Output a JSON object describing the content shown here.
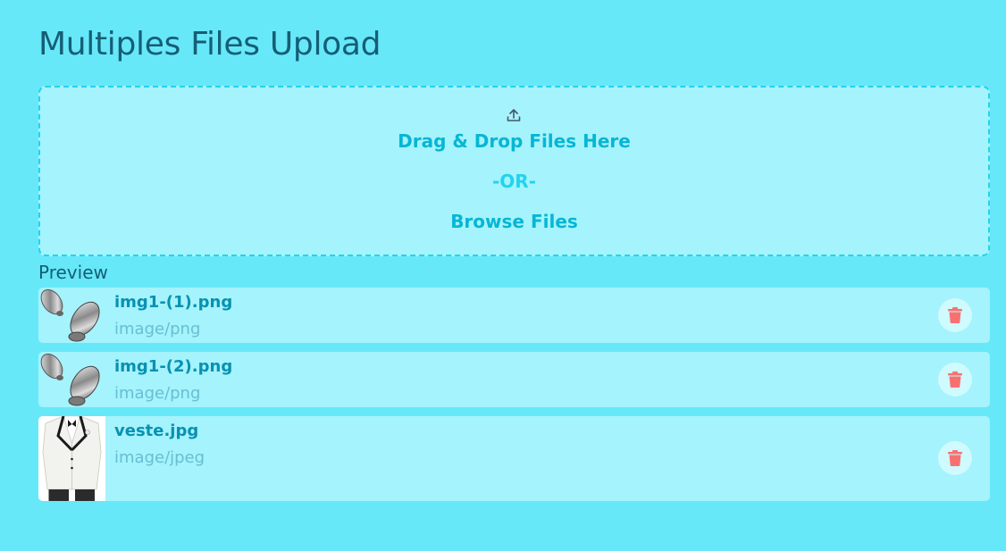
{
  "page": {
    "title": "Multiples Files Upload"
  },
  "dropzone": {
    "icon": "upload-icon",
    "drag_text": "Drag & Drop Files Here",
    "or_text": "-OR-",
    "browse_text": "Browse Files"
  },
  "preview": {
    "label": "Preview",
    "files": [
      {
        "name": "img1-(1).png",
        "type": "image/png",
        "thumbnail": "chrome-spoon-thumbnail"
      },
      {
        "name": "img1-(2).png",
        "type": "image/png",
        "thumbnail": "chrome-spoon-thumbnail"
      },
      {
        "name": "veste.jpg",
        "type": "image/jpeg",
        "thumbnail": "tuxedo-jacket-thumbnail"
      }
    ],
    "delete_icon": "trash-icon"
  },
  "colors": {
    "background": "#67e8f9",
    "dropzone_bg": "#a5f3fc",
    "accent": "#06b6d4",
    "title": "#155e75",
    "delete": "#f87171"
  }
}
